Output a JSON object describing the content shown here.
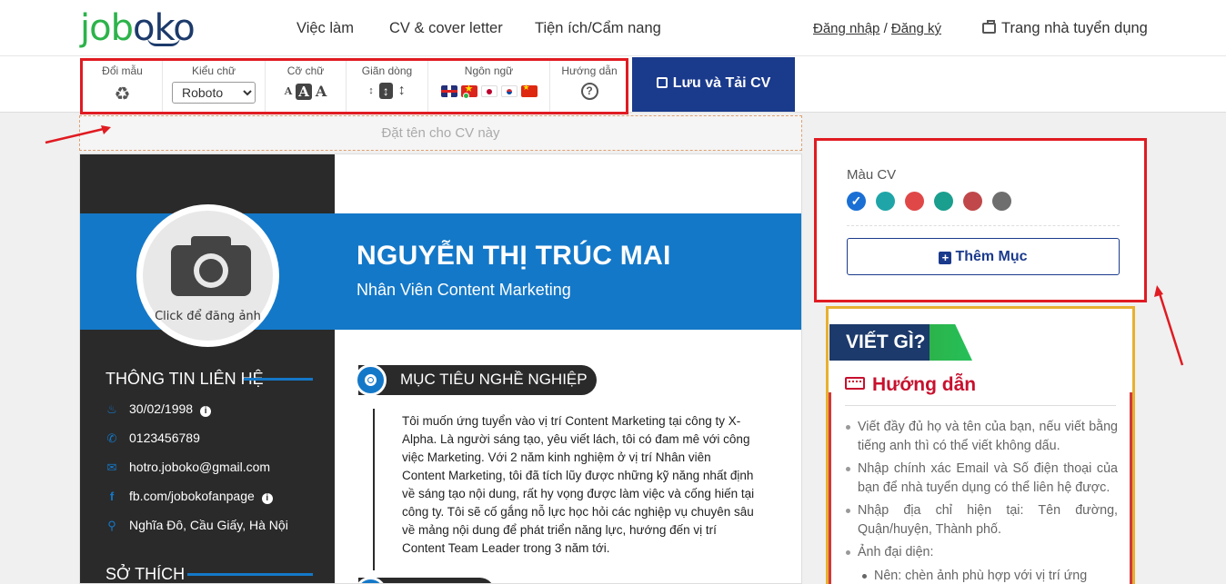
{
  "header": {
    "logo_green": "job",
    "logo_blue": "oko",
    "nav": [
      "Việc làm",
      "CV & cover letter",
      "Tiện ích/Cẩm nang"
    ],
    "login": "Đăng nhập",
    "separator": "/",
    "register": "Đăng ký",
    "employer": "Trang nhà tuyển dụng"
  },
  "toolbar": {
    "color_label": "Đổi mẫu",
    "font_label": "Kiểu chữ",
    "font_value": "Roboto",
    "size_label": "Cỡ chữ",
    "size_glyph": "A",
    "spacing_label": "Giãn dòng",
    "spacing_glyph": "↕",
    "language_label": "Ngôn ngữ",
    "help_label": "Hướng dẫn",
    "help_glyph": "?",
    "save_label": "Lưu và Tải CV",
    "recycle_glyph": "♻"
  },
  "cv_name_placeholder": "Đặt tên cho CV này",
  "cv": {
    "name": "NGUYỄN THỊ TRÚC MAI",
    "role": "Nhân Viên Content Marketing",
    "avatar_text": "Click để đăng ảnh",
    "contact_heading": "THÔNG TIN LIÊN HỆ",
    "contacts": [
      {
        "icon": "birthday-cake-icon",
        "glyph": "♨",
        "text": "30/02/1998"
      },
      {
        "icon": "phone-icon",
        "glyph": "✆",
        "text": "0123456789"
      },
      {
        "icon": "email-icon",
        "glyph": "✉",
        "text": "hotro.joboko@gmail.com"
      },
      {
        "icon": "facebook-icon",
        "glyph": "f",
        "text": "fb.com/jobokofanpage"
      },
      {
        "icon": "location-icon",
        "glyph": "⚲",
        "text": "Nghĩa Đô, Cầu Giấy, Hà Nội"
      }
    ],
    "info_glyph": "i",
    "hobby_heading": "SỞ THÍCH",
    "objective_heading": "MỤC TIÊU NGHỀ NGHIỆP",
    "objective_text": "Tôi muốn ứng tuyển vào vị trí Content Marketing tại công ty X-Alpha. Là người sáng tạo, yêu viết lách, tôi có đam mê với công việc Marketing. Với 2 năm kinh nghiệm ở vị trí Nhân viên Content Marketing, tôi đã tích lũy được những kỹ năng nhất định về sáng tạo nội dung, rất hy vọng được làm việc và cống hiến tại công ty. Tôi sẽ cố gắng nỗ lực học hỏi các nghiệp vụ chuyên sâu về mảng nội dung để phát triển năng lực, hướng đến vị trí Content Team Leader trong 3 năm tới."
  },
  "color_panel": {
    "label": "Màu CV",
    "swatches": [
      "#1a6fd4",
      "#1fa5a8",
      "#e04848",
      "#1a9e8e",
      "#c0484a",
      "#6e6e6e"
    ],
    "selected_index": 0,
    "add_label": "Thêm Mục",
    "plus_glyph": "+"
  },
  "guide": {
    "banner": "VIẾT GÌ?",
    "title": "Hướng dẫn",
    "items": [
      "Viết đầy đủ họ và tên của bạn, nếu viết bằng tiếng anh thì có thể viết không dấu.",
      "Nhập chính xác Email và Số điện thoại của bạn để nhà tuyển dụng có thể liên hệ được.",
      "Nhập địa chỉ hiện tại: Tên đường, Quận/huyện, Thành phố.",
      "Ảnh đại diện:",
      "Nên: chèn ảnh phù hợp với vị trí ứng"
    ]
  }
}
